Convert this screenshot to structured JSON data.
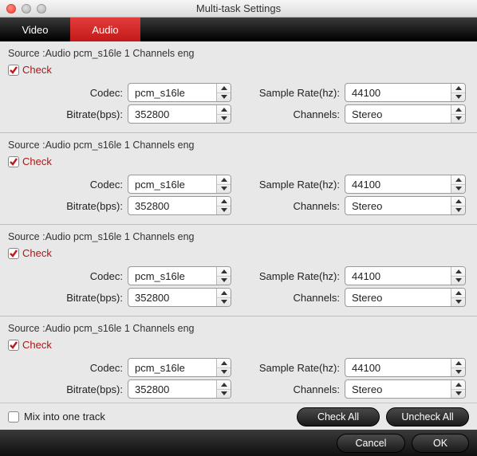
{
  "window": {
    "title": "Multi-task Settings"
  },
  "tabs": {
    "video": "Video",
    "audio": "Audio",
    "active": "audio"
  },
  "labels": {
    "source_prefix": "Source :",
    "check": "Check",
    "codec": "Codec:",
    "bitrate": "Bitrate(bps):",
    "samplerate": "Sample Rate(hz):",
    "channels": "Channels:"
  },
  "tracks": [
    {
      "source": "Audio  pcm_s16le  1 Channels  eng",
      "checked": true,
      "codec": "pcm_s16le",
      "bitrate": "352800",
      "samplerate": "44100",
      "channels": "Stereo"
    },
    {
      "source": "Audio  pcm_s16le  1 Channels  eng",
      "checked": true,
      "codec": "pcm_s16le",
      "bitrate": "352800",
      "samplerate": "44100",
      "channels": "Stereo"
    },
    {
      "source": "Audio  pcm_s16le  1 Channels  eng",
      "checked": true,
      "codec": "pcm_s16le",
      "bitrate": "352800",
      "samplerate": "44100",
      "channels": "Stereo"
    },
    {
      "source": "Audio  pcm_s16le  1 Channels  eng",
      "checked": true,
      "codec": "pcm_s16le",
      "bitrate": "352800",
      "samplerate": "44100",
      "channels": "Stereo"
    }
  ],
  "footer": {
    "mix": "Mix into one track",
    "checkall": "Check All",
    "uncheckall": "Uncheck All",
    "cancel": "Cancel",
    "ok": "OK"
  }
}
